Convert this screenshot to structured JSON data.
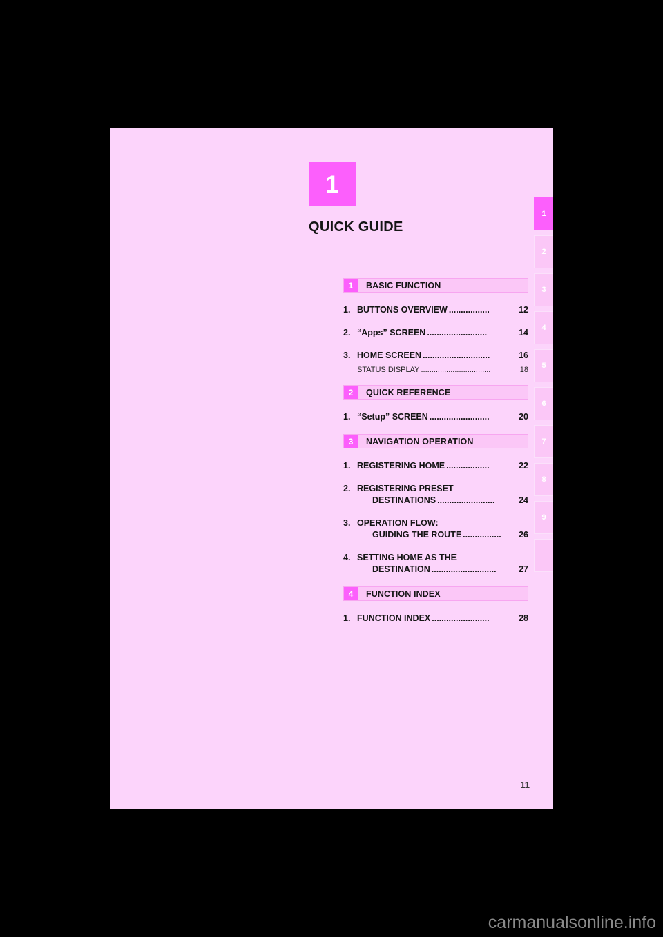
{
  "chapter": {
    "number": "1",
    "title": "QUICK GUIDE"
  },
  "page_number": "11",
  "watermark": "carmanualsonline.info",
  "colors": {
    "accent": "#fc5ffc",
    "page_background": "#fcd4fb",
    "header_bar_background": "#fbc7f7",
    "header_bar_border": "#f7a6f0",
    "text": "#151515"
  },
  "toc": {
    "sections": [
      {
        "number": "1",
        "label": "BASIC FUNCTION",
        "entries": [
          {
            "index": "1.",
            "lines": [
              "BUTTONS OVERVIEW"
            ],
            "page": "12",
            "leader": "................."
          },
          {
            "index": "2.",
            "lines": [
              "“Apps” SCREEN"
            ],
            "page": "14",
            "leader": "........................."
          },
          {
            "index": "3.",
            "lines": [
              "HOME SCREEN"
            ],
            "page": "16",
            "leader": "............................",
            "sub": {
              "label": "STATUS DISPLAY",
              "page": "18",
              "leader": "................................."
            }
          }
        ]
      },
      {
        "number": "2",
        "label": "QUICK REFERENCE",
        "entries": [
          {
            "index": "1.",
            "lines": [
              "“Setup” SCREEN"
            ],
            "page": "20",
            "leader": "........................."
          }
        ]
      },
      {
        "number": "3",
        "label": "NAVIGATION OPERATION",
        "entries": [
          {
            "index": "1.",
            "lines": [
              "REGISTERING HOME"
            ],
            "page": "22",
            "leader": ".................."
          },
          {
            "index": "2.",
            "lines": [
              "REGISTERING PRESET",
              "DESTINATIONS"
            ],
            "page": "24",
            "leader": "........................"
          },
          {
            "index": "3.",
            "lines": [
              "OPERATION FLOW:",
              "GUIDING THE ROUTE"
            ],
            "page": "26",
            "leader": "................"
          },
          {
            "index": "4.",
            "lines": [
              "SETTING HOME AS THE",
              "DESTINATION"
            ],
            "page": "27",
            "leader": "..........................."
          }
        ]
      },
      {
        "number": "4",
        "label": "FUNCTION INDEX",
        "entries": [
          {
            "index": "1.",
            "lines": [
              "FUNCTION INDEX"
            ],
            "page": "28",
            "leader": "........................"
          }
        ]
      }
    ]
  },
  "side_tabs": [
    {
      "label": "1",
      "active": true
    },
    {
      "label": "2",
      "active": false
    },
    {
      "label": "3",
      "active": false
    },
    {
      "label": "4",
      "active": false
    },
    {
      "label": "5",
      "active": false
    },
    {
      "label": "6",
      "active": false
    },
    {
      "label": "7",
      "active": false
    },
    {
      "label": "8",
      "active": false
    },
    {
      "label": "9",
      "active": false
    },
    {
      "label": "",
      "active": false
    }
  ]
}
